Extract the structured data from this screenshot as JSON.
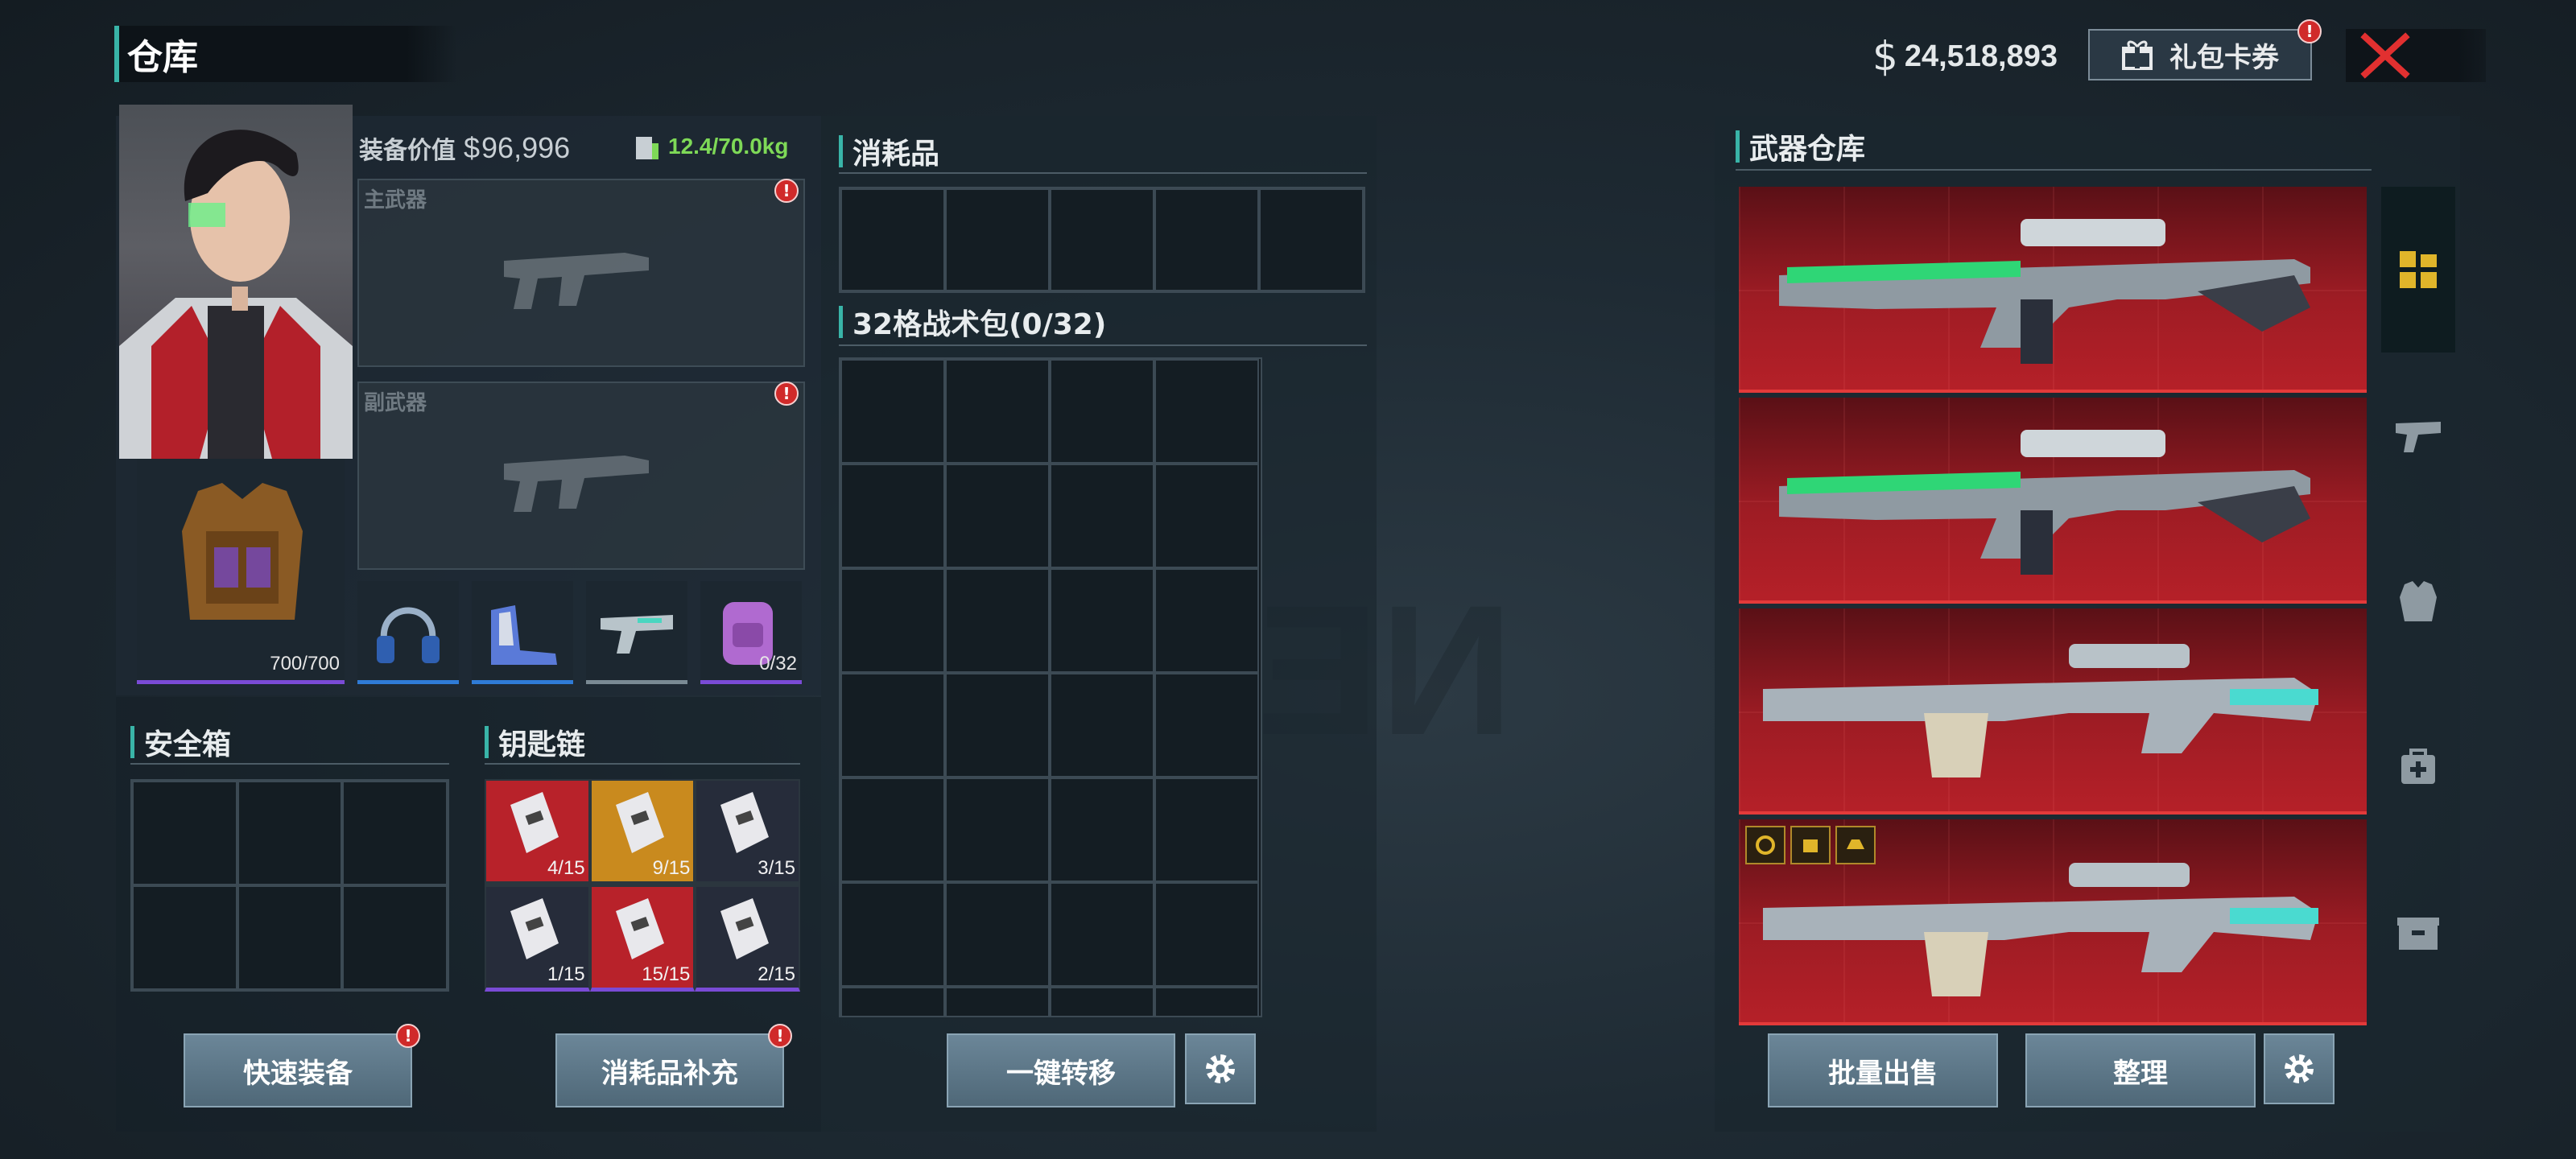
{
  "header": {
    "title": "仓库",
    "currency_symbol": "$",
    "money": "24,518,893",
    "gift_label": "礼包卡券",
    "gift_badge": "!"
  },
  "loadout": {
    "equip_value_label": "装备价值",
    "equip_value_symbol": "$",
    "equip_value": "96,996",
    "weight": "12.4/70.0kg",
    "primary_label": "主武器",
    "secondary_label": "副武器",
    "badge": "!",
    "armor_durability": "700/700",
    "backpack_capacity": "0/32"
  },
  "consumables": {
    "title": "消耗品"
  },
  "tactical_bag": {
    "title": "32格战术包(0/32)"
  },
  "safe_box": {
    "title": "安全箱"
  },
  "keychain": {
    "title": "钥匙链",
    "keys": [
      {
        "count": "4/15",
        "color": "#b8222a"
      },
      {
        "count": "9/15",
        "color": "#c98a1e"
      },
      {
        "count": "3/15",
        "color": "#262c3a"
      },
      {
        "count": "1/15",
        "color": "#262c3a"
      },
      {
        "count": "15/15",
        "color": "#b8222a"
      },
      {
        "count": "2/15",
        "color": "#262c3a"
      }
    ]
  },
  "buttons": {
    "quick_equip": "快速装备",
    "refill": "消耗品补充",
    "transfer": "一键转移",
    "bulk_sell": "批量出售",
    "sort": "整理",
    "badge": "!"
  },
  "weapon_storage": {
    "title": "武器仓库",
    "tabs": [
      "grid-icon",
      "pistol-icon",
      "armor-icon",
      "medkit-icon",
      "crate-icon"
    ]
  },
  "colors": {
    "accent": "#39b4a8",
    "weight_green": "#7ed957",
    "epic_purple": "#7a4bd6",
    "rare_blue": "#2f7bd6",
    "weapon_red": "#b52028",
    "tab_gold": "#e0b52a"
  }
}
